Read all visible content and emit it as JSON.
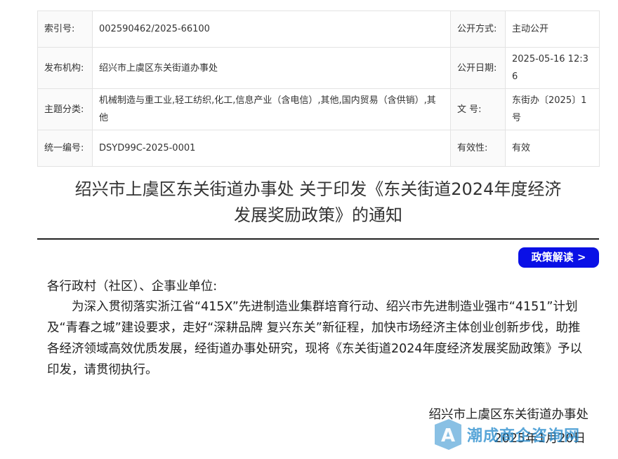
{
  "meta_table": {
    "index_label": "索引号:",
    "index_value": "002590462/2025-66100",
    "disclosure_label": "公开方式:",
    "disclosure_value": "主动公开",
    "publisher_label": "发布机构:",
    "publisher_value": "绍兴市上虞区东关街道办事处",
    "date_label": "公开日期:",
    "date_value": "2025-05-16 12:36",
    "topic_label": "主题分类:",
    "topic_value": "机械制造与重工业,轻工纺织,化工,信息产业（含电信）,其他,国内贸易（含供销）,其他",
    "docno_label": "文 号:",
    "docno_value": "东街办〔2025〕1号",
    "code_label": "统一编号:",
    "code_value": "DSYD99C-2025-0001",
    "validity_label": "有效性:",
    "validity_value": "有效"
  },
  "title_line1": "绍兴市上虞区东关街道办事处 关于印发《东关街道2024年度经济",
  "title_line2": "发展奖励政策》的通知",
  "interpretation_button": "政策解读 >",
  "salutation": "各行政村（社区）、企事业单位:",
  "body": "为深入贯彻落实浙江省“415X”先进制造业集群培育行动、绍兴市先进制造业强市“4151”计划及“青春之城”建设要求，走好“深耕品牌 复兴东关”新征程，加快市场经济主体创业创新步伐，助推各经济领域高效优质发展，经街道办事处研究，现将《东关街道2024年度经济发展奖励政策》予以印发，请贯彻执行。",
  "signature": "绍兴市上虞区东关街道办事处",
  "date": "2025年1月20日",
  "watermark": {
    "text": "潮成商企咨询网",
    "logo_icon": "letter-a-logo-icon",
    "color": "#288ccd"
  }
}
